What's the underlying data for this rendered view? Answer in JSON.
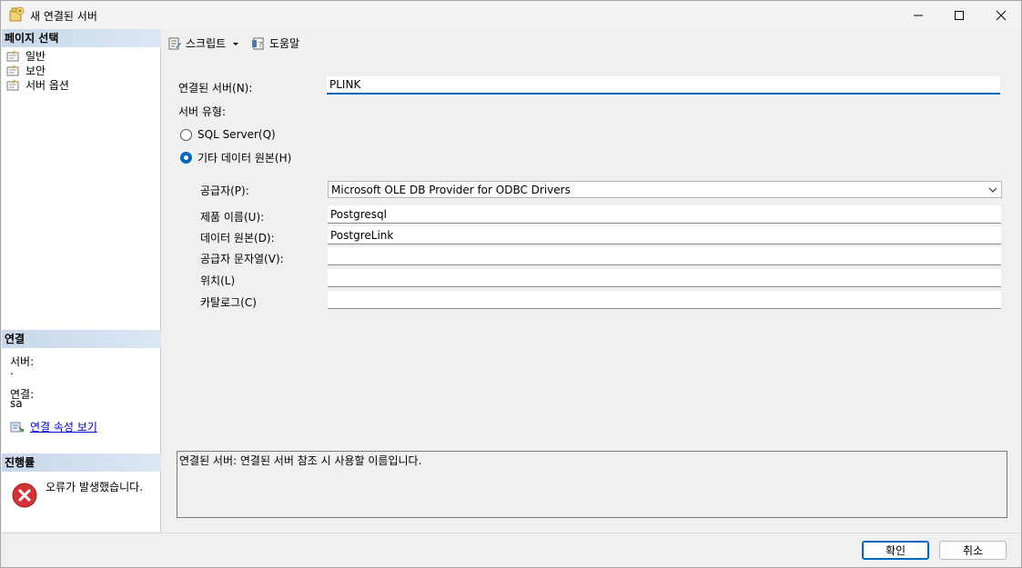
{
  "window": {
    "title": "새 연결된 서버",
    "title_icon": "linked-server-icon"
  },
  "left_pane": {
    "pages_header": "페이지 선택",
    "pages": [
      {
        "label": "일반",
        "icon": "page-icon"
      },
      {
        "label": "보안",
        "icon": "page-icon"
      },
      {
        "label": "서버 옵션",
        "icon": "page-icon"
      }
    ],
    "connection_header": "연결",
    "server_label": "서버:",
    "server_value": ".",
    "connection_label": "연결:",
    "connection_value": "sa",
    "view_props_link": "연결 속성 보기",
    "progress_header": "진행률",
    "progress_text": "오류가 발생했습니다."
  },
  "toolbar": {
    "script_label": "스크립트",
    "help_label": "도움말"
  },
  "form": {
    "linked_server_label": "연결된 서버(N):",
    "linked_server_value": "PLINK",
    "server_type_label": "서버 유형:",
    "radio_sql_server": "SQL Server(Q)",
    "radio_other_source": "기타 데이터 원본(H)",
    "selected_server_type": "기타 데이터 원본(H)",
    "provider_label": "공급자(P):",
    "provider_value": "Microsoft OLE DB Provider for ODBC Drivers",
    "product_name_label": "제품 이름(U):",
    "product_name_value": "Postgresql",
    "data_source_label": "데이터 원본(D):",
    "data_source_value": "PostgreLink",
    "provider_string_label": "공급자 문자열(V):",
    "provider_string_value": "",
    "location_label": "위치(L)",
    "location_value": "",
    "catalog_label": "카탈로그(C)",
    "catalog_value": ""
  },
  "description": "연결된 서버: 연결된 서버 참조 시 사용할 이름입니다.",
  "buttons": {
    "ok": "확인",
    "cancel": "취소"
  },
  "colors": {
    "accent": "#0067c0",
    "pane_header": "#c8d8ea",
    "error": "#d13438"
  }
}
